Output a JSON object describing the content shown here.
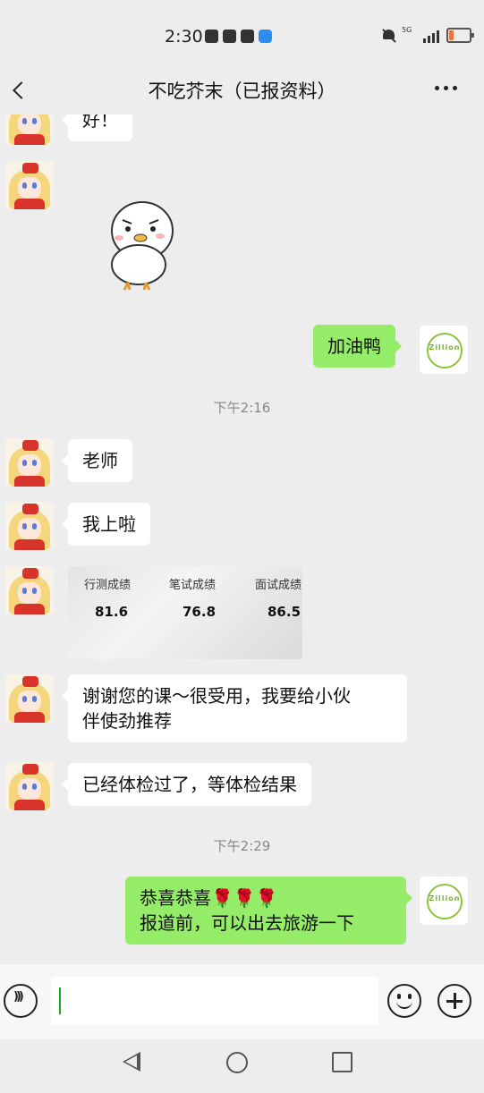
{
  "status_bar": {
    "time": "2:30",
    "network_label": "5G",
    "battery_color": "#e8743b"
  },
  "header": {
    "title": "不吃芥末（已报资料）"
  },
  "messages": [
    {
      "from": "other",
      "type": "text",
      "text": "好！"
    },
    {
      "from": "other",
      "type": "sticker",
      "sticker": "cheering-duck"
    },
    {
      "from": "self",
      "type": "text",
      "text": "加油鸭"
    },
    {
      "type": "timestamp",
      "text": "下午2:16"
    },
    {
      "from": "other",
      "type": "text",
      "text": "老师"
    },
    {
      "from": "other",
      "type": "text",
      "text": "我上啦"
    },
    {
      "from": "other",
      "type": "image",
      "headers": [
        "行测成绩",
        "笔试成绩",
        "面试成绩"
      ],
      "values": [
        "81.6",
        "76.8",
        "86.5"
      ]
    },
    {
      "from": "other",
      "type": "text",
      "line1": "谢谢您的课～很受用，我要给小伙",
      "line2": "伴使劲推荐"
    },
    {
      "from": "other",
      "type": "text",
      "text": "已经体检过了，等体检结果"
    },
    {
      "type": "timestamp",
      "text": "下午2:29"
    },
    {
      "from": "self",
      "type": "text",
      "line1": "恭喜恭喜🌹🌹🌹",
      "line2": "报道前，可以出去旅游一下"
    }
  ],
  "self_avatar": {
    "logo_text": "Zillion"
  },
  "input_bar": {
    "value": ""
  },
  "colors": {
    "self_bubble": "#95ec69",
    "other_bubble": "#ffffff",
    "background": "#ededed"
  }
}
